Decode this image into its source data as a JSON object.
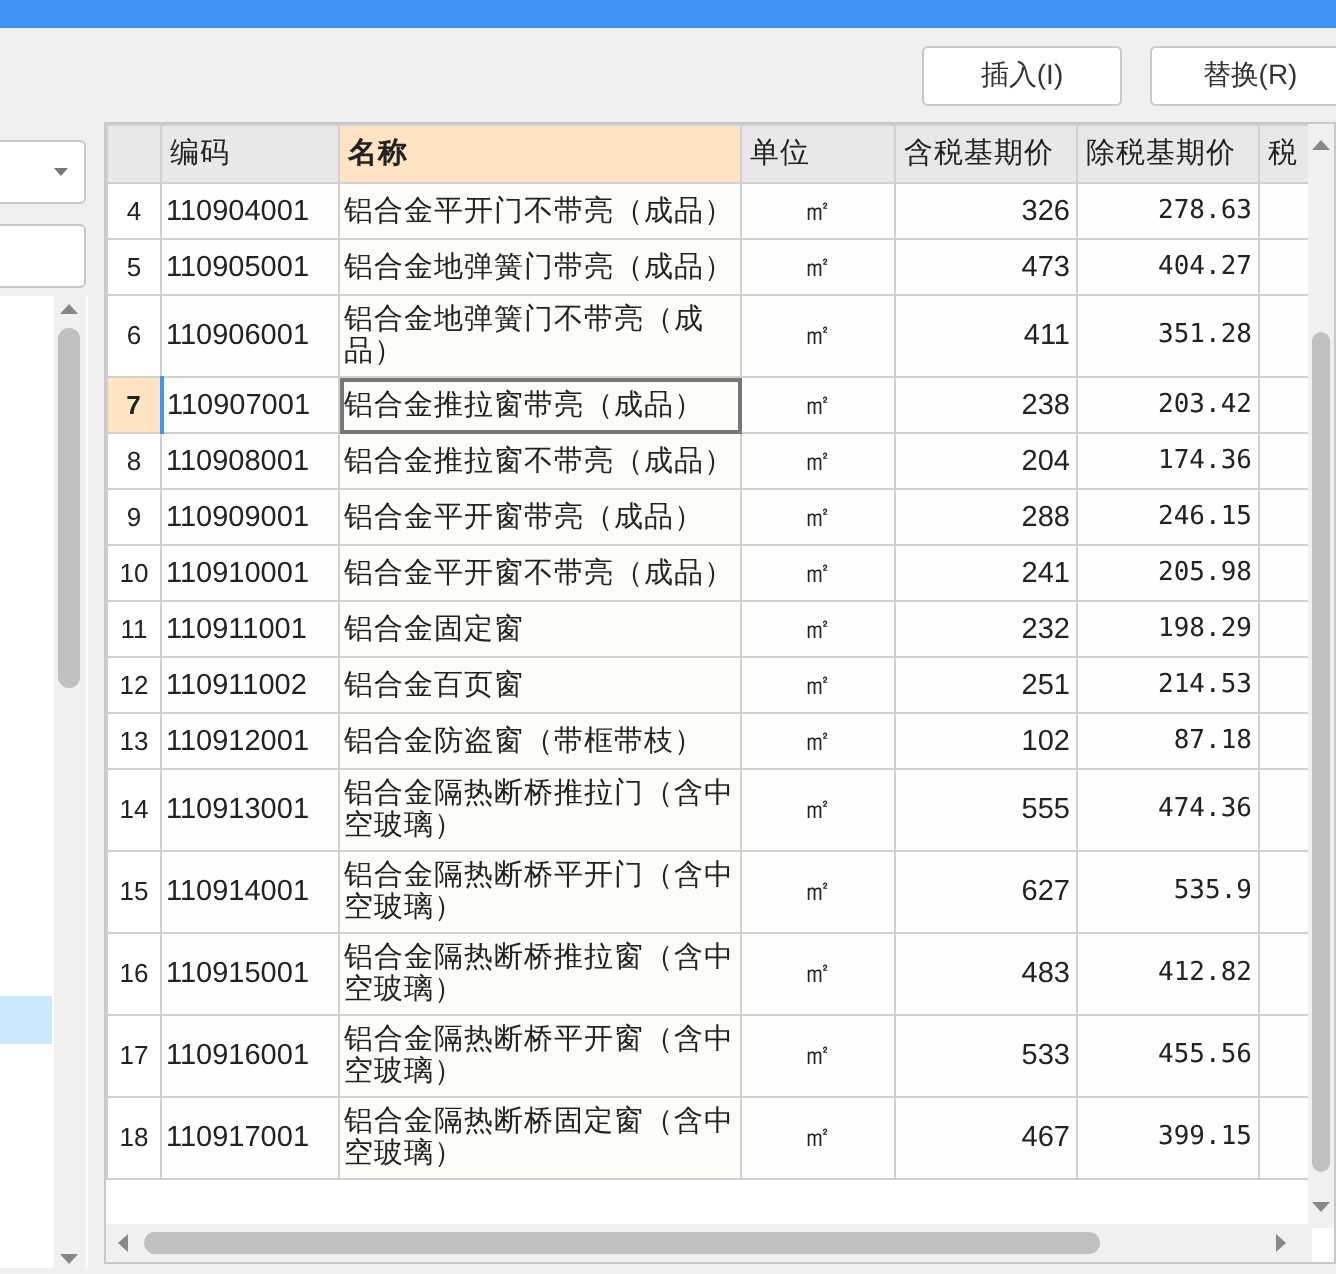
{
  "toolbar": {
    "buttons": [
      "插入(I)",
      "替换(R)"
    ]
  },
  "table": {
    "columns": [
      {
        "label": "编码",
        "selected": false
      },
      {
        "label": "名称",
        "selected": true
      },
      {
        "label": "单位",
        "selected": false
      },
      {
        "label": "含税基期价",
        "selected": false
      },
      {
        "label": "除税基期价",
        "selected": false
      },
      {
        "label": "税",
        "selected": false
      }
    ],
    "rows": [
      {
        "index": "4",
        "code": "110904001",
        "name": "铝合金平开门不带亮（成品）",
        "unit": "㎡",
        "price_incl": "326",
        "price_excl": "278.63",
        "selected": false
      },
      {
        "index": "5",
        "code": "110905001",
        "name": "铝合金地弹簧门带亮（成品）",
        "unit": "㎡",
        "price_incl": "473",
        "price_excl": "404.27",
        "selected": false
      },
      {
        "index": "6",
        "code": "110906001",
        "name": "铝合金地弹簧门不带亮（成品）",
        "unit": "㎡",
        "price_incl": "411",
        "price_excl": "351.28",
        "selected": false
      },
      {
        "index": "7",
        "code": "110907001",
        "name": "铝合金推拉窗带亮（成品）",
        "unit": "㎡",
        "price_incl": "238",
        "price_excl": "203.42",
        "selected": true
      },
      {
        "index": "8",
        "code": "110908001",
        "name": "铝合金推拉窗不带亮（成品）",
        "unit": "㎡",
        "price_incl": "204",
        "price_excl": "174.36",
        "selected": false
      },
      {
        "index": "9",
        "code": "110909001",
        "name": "铝合金平开窗带亮（成品）",
        "unit": "㎡",
        "price_incl": "288",
        "price_excl": "246.15",
        "selected": false
      },
      {
        "index": "10",
        "code": "110910001",
        "name": "铝合金平开窗不带亮（成品）",
        "unit": "㎡",
        "price_incl": "241",
        "price_excl": "205.98",
        "selected": false
      },
      {
        "index": "11",
        "code": "110911001",
        "name": "铝合金固定窗",
        "unit": "㎡",
        "price_incl": "232",
        "price_excl": "198.29",
        "selected": false
      },
      {
        "index": "12",
        "code": "110911002",
        "name": "铝合金百页窗",
        "unit": "㎡",
        "price_incl": "251",
        "price_excl": "214.53",
        "selected": false
      },
      {
        "index": "13",
        "code": "110912001",
        "name": "铝合金防盗窗（带框带枝）",
        "unit": "㎡",
        "price_incl": "102",
        "price_excl": "87.18",
        "selected": false
      },
      {
        "index": "14",
        "code": "110913001",
        "name": "铝合金隔热断桥推拉门（含中空玻璃）",
        "unit": "㎡",
        "price_incl": "555",
        "price_excl": "474.36",
        "selected": false
      },
      {
        "index": "15",
        "code": "110914001",
        "name": "铝合金隔热断桥平开门（含中空玻璃）",
        "unit": "㎡",
        "price_incl": "627",
        "price_excl": "535.9",
        "selected": false
      },
      {
        "index": "16",
        "code": "110915001",
        "name": "铝合金隔热断桥推拉窗（含中空玻璃）",
        "unit": "㎡",
        "price_incl": "483",
        "price_excl": "412.82",
        "selected": false
      },
      {
        "index": "17",
        "code": "110916001",
        "name": "铝合金隔热断桥平开窗（含中空玻璃）",
        "unit": "㎡",
        "price_incl": "533",
        "price_excl": "455.56",
        "selected": false
      },
      {
        "index": "18",
        "code": "110917001",
        "name": "铝合金隔热断桥固定窗（含中空玻璃）",
        "unit": "㎡",
        "price_incl": "467",
        "price_excl": "399.15",
        "selected": false
      }
    ]
  }
}
